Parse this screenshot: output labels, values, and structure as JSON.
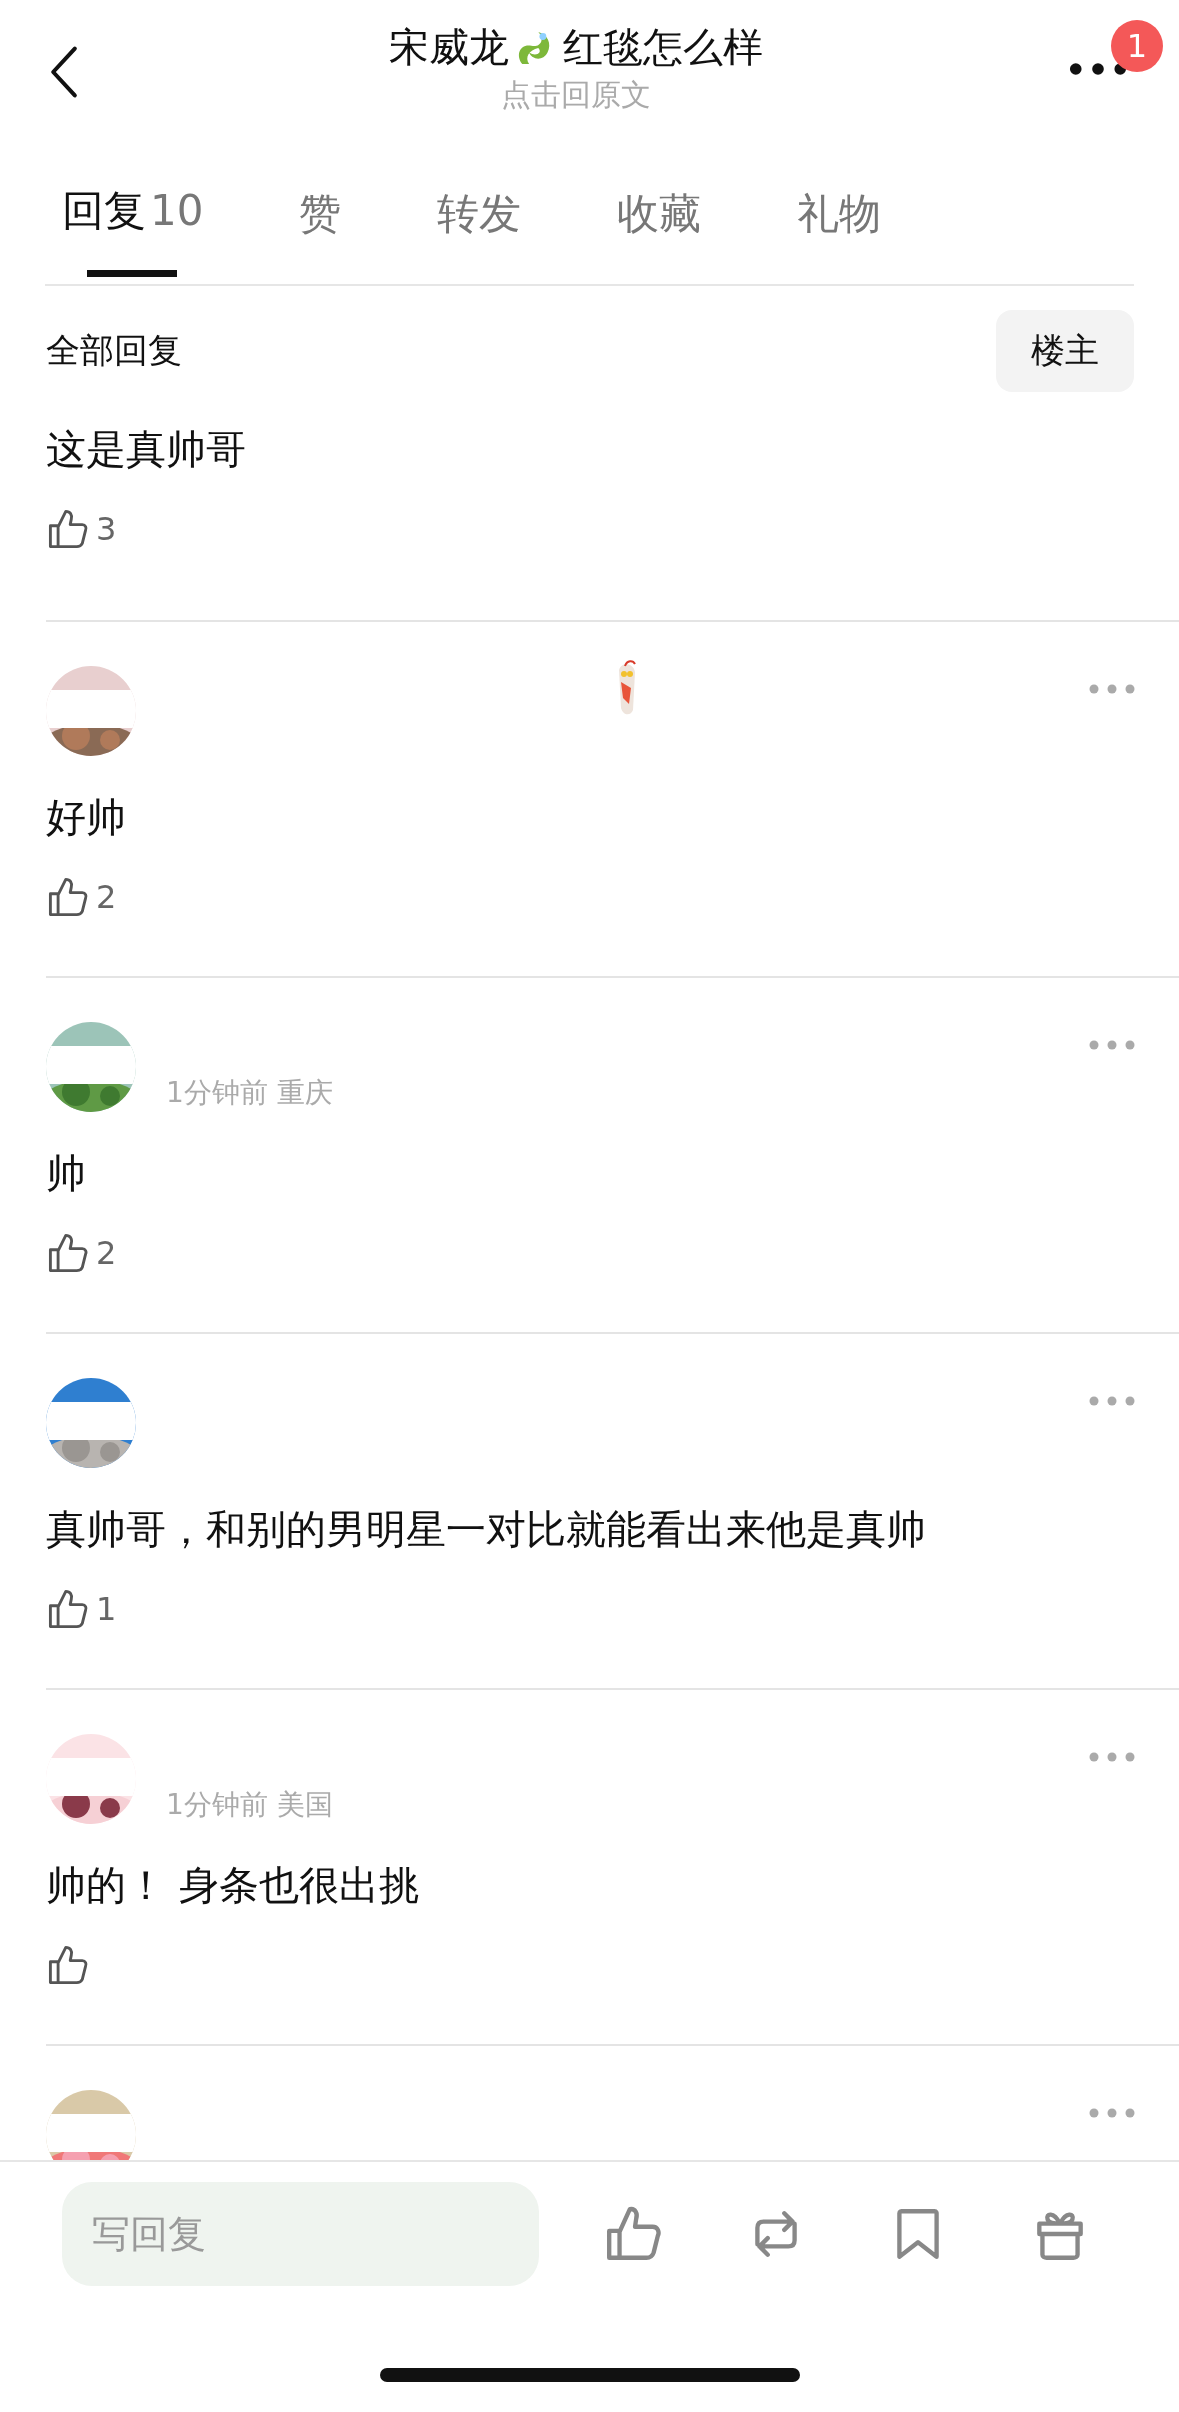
{
  "header": {
    "title_before": "宋威龙",
    "title_after": "红毯怎么样",
    "subtitle": "点击回原文",
    "badge": "1"
  },
  "tabs": [
    {
      "label": "回复",
      "count": "10",
      "selected": true
    },
    {
      "label": "赞",
      "selected": false
    },
    {
      "label": "转发",
      "selected": false
    },
    {
      "label": "收藏",
      "selected": false
    },
    {
      "label": "礼物",
      "selected": false
    }
  ],
  "filter": {
    "label": "全部回复",
    "button": "楼主"
  },
  "comments": [
    {
      "text": "这是真帅哥",
      "likes": "3"
    },
    {
      "avatar": {
        "kind": "picture"
      },
      "sticker": true,
      "text": "好帅",
      "likes": "2"
    },
    {
      "avatar": {
        "kind": "picture"
      },
      "meta": "1分钟前 重庆",
      "text": "帅",
      "likes": "2"
    },
    {
      "avatar": {
        "kind": "picture"
      },
      "text": "真帅哥，和别的男明星一对比就能看出来他是真帅",
      "likes": "1"
    },
    {
      "avatar": {
        "kind": "picture"
      },
      "meta": "1分钟前 美国",
      "text": "帅的！ 身条也很出挑"
    },
    {
      "avatar": {
        "kind": "picture"
      }
    }
  ],
  "reply_bar": {
    "placeholder": "写回复"
  }
}
